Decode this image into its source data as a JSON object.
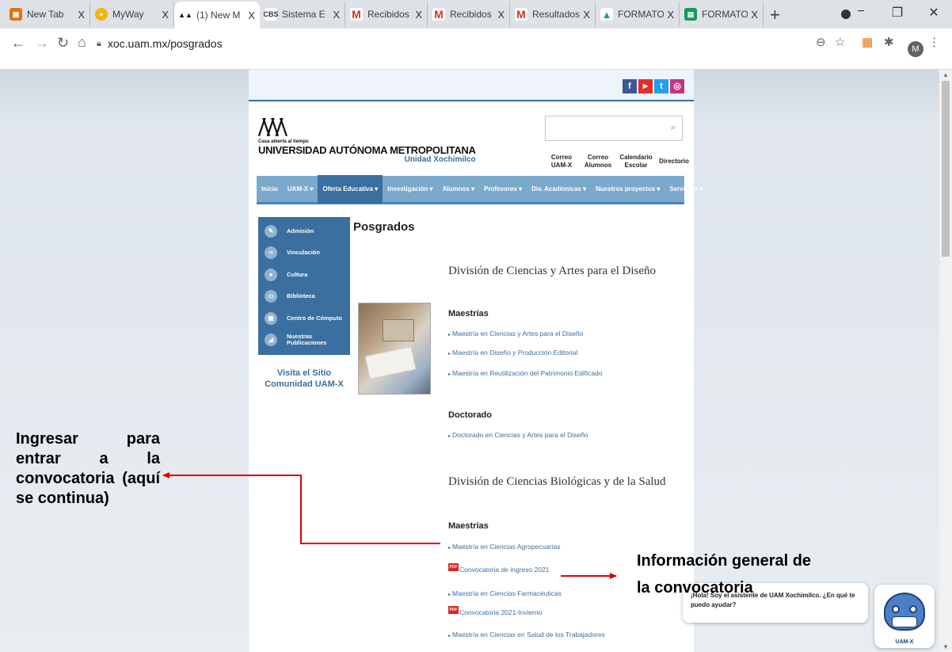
{
  "browser": {
    "tabs": [
      {
        "label": "New Tab",
        "favicon": "google-apps-icon",
        "color": "#e8710a",
        "active": false
      },
      {
        "label": "MyWay",
        "favicon": "myway-icon",
        "color": "#f4b400",
        "active": false
      },
      {
        "label": "(1) New M",
        "favicon": "uam-icon",
        "color": "#111111",
        "active": true
      },
      {
        "label": "Sistema E",
        "favicon": "cbs-icon",
        "color": "#333333",
        "active": false
      },
      {
        "label": "Recibidos",
        "favicon": "gmail-icon",
        "color": "#d93025",
        "active": false
      },
      {
        "label": "Recibidos",
        "favicon": "gmail-icon",
        "color": "#d93025",
        "active": false
      },
      {
        "label": "Resultados",
        "favicon": "gmail-icon",
        "color": "#d93025",
        "active": false
      },
      {
        "label": "FORMATO",
        "favicon": "google-drive-icon",
        "color": "#1fa463",
        "active": false
      },
      {
        "label": "FORMATO",
        "favicon": "google-sheets-icon",
        "color": "#0f9d58",
        "active": false
      }
    ],
    "close_glyph": "X",
    "new_tab_glyph": "+",
    "url": "xoc.uam.mx/posgrados",
    "avatar_letter": "M"
  },
  "site": {
    "social_icons": [
      {
        "name": "facebook-icon",
        "glyph": "f",
        "color": "#3b5998"
      },
      {
        "name": "youtube-icon",
        "glyph": "▶",
        "color": "#e52d27"
      },
      {
        "name": "twitter-icon",
        "glyph": "t",
        "color": "#1da1f2"
      },
      {
        "name": "instagram-icon",
        "glyph": "◎",
        "color": "#c13584"
      }
    ],
    "logo": {
      "small": "Casa abierta al tiempo",
      "university": "UNIVERSIDAD AUTÓNOMA METROPOLITANA",
      "unit": "Unidad Xochimilco"
    },
    "top_links": [
      {
        "line1": "Correo",
        "line2": "UAM-X"
      },
      {
        "line1": "Correo",
        "line2": "Alumnos"
      },
      {
        "line1": "Calendario",
        "line2": "Escolar"
      },
      {
        "line1": "Directorio",
        "line2": ""
      }
    ],
    "main_nav": [
      {
        "label": "Inicio",
        "selected": false
      },
      {
        "label": "UAM-X ▾",
        "selected": false
      },
      {
        "label": "Oferta Educativa ▾",
        "selected": true
      },
      {
        "label": "Investigación ▾",
        "selected": false
      },
      {
        "label": "Alumnos ▾",
        "selected": false
      },
      {
        "label": "Profesores ▾",
        "selected": false
      },
      {
        "label": "Div. Académicas ▾",
        "selected": false
      },
      {
        "label": "Nuestros proyectos ▾",
        "selected": false
      },
      {
        "label": "Servicios ▾",
        "selected": false
      }
    ],
    "side_menu": [
      {
        "label": "Admisión",
        "icon": "pencil-icon"
      },
      {
        "label": "Vinculación",
        "icon": "link-icon"
      },
      {
        "label": "Cultura",
        "icon": "microphone-icon"
      },
      {
        "label": "Biblioteca",
        "icon": "book-icon"
      },
      {
        "label": "Centro de Cómputo",
        "icon": "computer-icon"
      },
      {
        "label": "Nuestras Publicaciones",
        "icon": "publication-icon"
      }
    ],
    "visit_line1": "Visita el Sitio",
    "visit_line2": "Comunidad UAM-X",
    "page_title": "Posgrados",
    "division1": "División de Ciencias y Artes para el Diseño",
    "maestrias_label": "Maestrías",
    "doctorado_label": "Doctorado",
    "d1_maestrias": [
      "Maestría en Ciencias y Artes para el Diseño",
      "Maestría en Diseño y Producción Editorial",
      "Maestría en Reutilización del Patrimonio Edificado"
    ],
    "d1_doctorado": "Doctorado en Ciencias y Artes para el Diseño",
    "division2": "División de Ciencias Biológicas y de la Salud",
    "d2_items": {
      "m1": "Maestría en Ciencias Agropecuarias",
      "pdf1": "Convocatoria de ingreso 2021",
      "m2": "Maestría en Ciencias Farmacéuticas",
      "pdf2": "Convocatoria 2021-Invierno",
      "m3": "Maestría en Ciencias en Salud de los Trabajadores"
    },
    "pdf_badge": "PDF"
  },
  "annotations": {
    "left": "Ingresar para entrar a la convocatoria (aquí se continua)",
    "right_line1": "Información general de",
    "right_line2": "la convocatoria",
    "arrow_color": "#e00000"
  },
  "chat": {
    "message": "¡Hola! Soy el asistente de UAM Xochimilco. ¿En qué te puedo ayudar?",
    "bot_label": "UAM-X"
  }
}
